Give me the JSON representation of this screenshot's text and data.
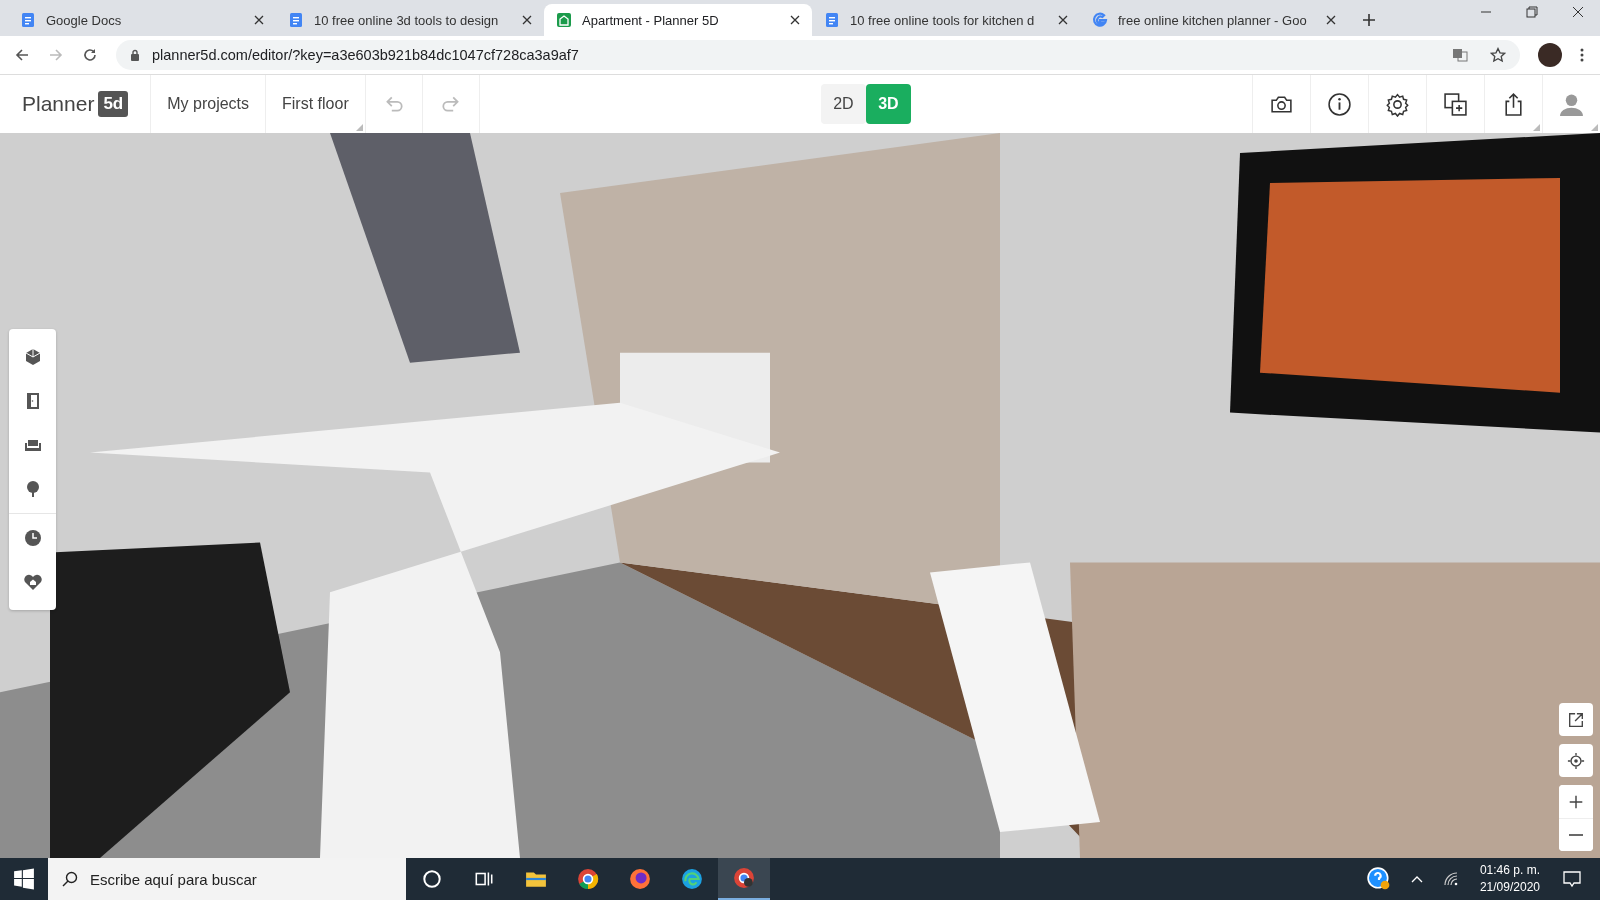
{
  "browser": {
    "tabs": [
      {
        "title": "Google Docs",
        "kind": "docs",
        "selected": false
      },
      {
        "title": "10 free online 3d tools to design",
        "kind": "docs",
        "selected": false
      },
      {
        "title": "Apartment - Planner 5D",
        "kind": "planner",
        "selected": true
      },
      {
        "title": "10 free online tools for kitchen d",
        "kind": "docs",
        "selected": false
      },
      {
        "title": "free online kitchen planner - Goo",
        "kind": "search",
        "selected": false
      }
    ],
    "url": "planner5d.com/editor/?key=a3e603b921b84dc1047cf728ca3a9af7"
  },
  "app": {
    "logo": {
      "text": "Planner",
      "badge": "5d"
    },
    "nav": [
      "My projects",
      "First floor"
    ],
    "view_modes": [
      {
        "label": "2D",
        "selected": false
      },
      {
        "label": "3D",
        "selected": true
      }
    ],
    "tools": [
      {
        "kind": "construction"
      },
      {
        "kind": "door"
      },
      {
        "kind": "sofa"
      },
      {
        "kind": "tree"
      },
      {
        "kind": "clock"
      },
      {
        "kind": "heart-home"
      }
    ]
  },
  "taskbar": {
    "search": {
      "placeholder": "Escribe aquí para buscar"
    },
    "time": "01:46 p. m.",
    "date": "21/09/2020"
  }
}
